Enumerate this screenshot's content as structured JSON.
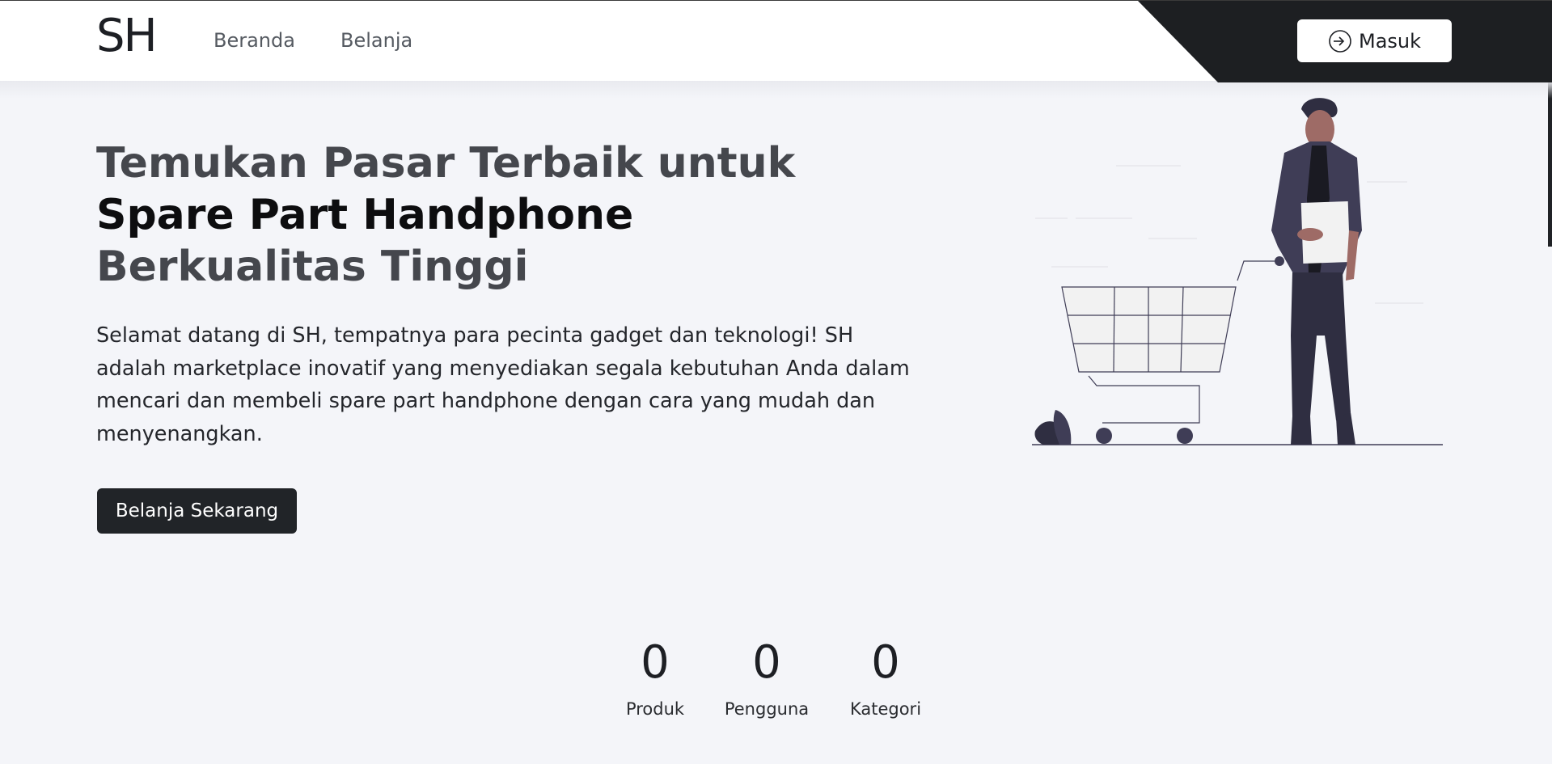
{
  "navbar": {
    "logo": "SH",
    "links": [
      {
        "label": "Beranda"
      },
      {
        "label": "Belanja"
      }
    ],
    "login_label": "Masuk",
    "dark_accent": "#1d1f22"
  },
  "hero": {
    "title_line1": "Temukan Pasar Terbaik untuk",
    "title_strong": "Spare Part Handphone",
    "title_rest": " Berkualitas Tinggi",
    "description": "Selamat datang di SH, tempatnya para pecinta gadget dan teknologi! SH adalah marketplace inovatif yang menyediakan segala kebutuhan Anda dalam mencari dan membeli spare part handphone dengan cara yang mudah dan menyenangkan.",
    "cta_label": "Belanja Sekarang"
  },
  "stats": [
    {
      "value": "0",
      "label": "Produk"
    },
    {
      "value": "0",
      "label": "Pengguna"
    },
    {
      "value": "0",
      "label": "Kategori"
    }
  ],
  "colors": {
    "background": "#f4f5f9",
    "button_dark": "#212428",
    "figure_body": "#3f3d56",
    "figure_skin": "#9e6b66"
  }
}
